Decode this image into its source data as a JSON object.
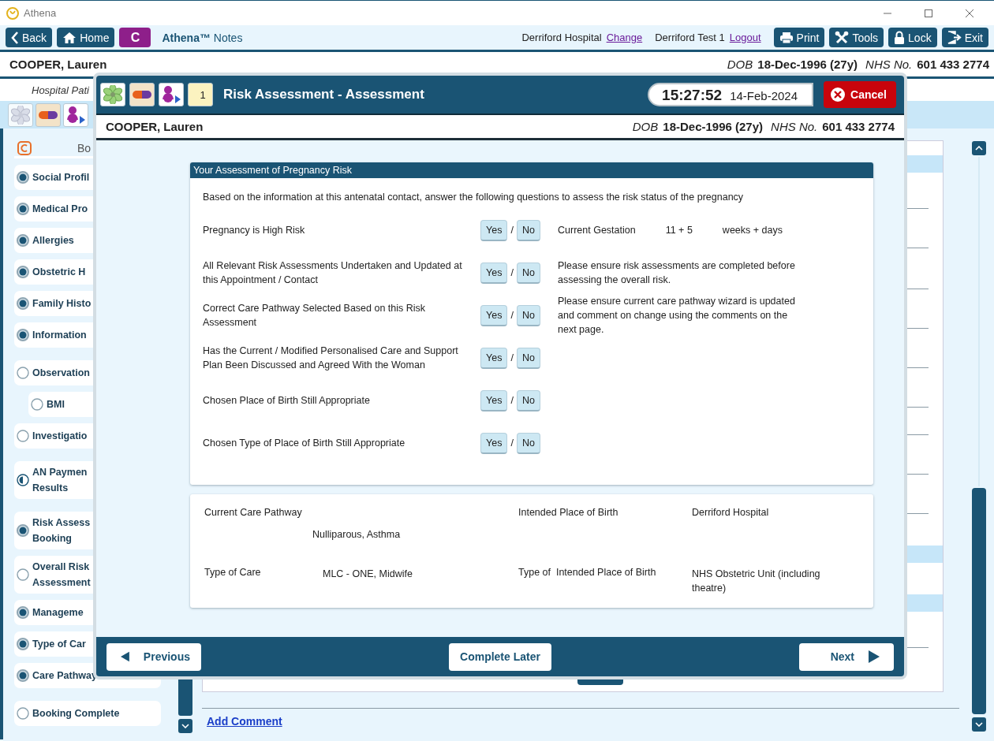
{
  "window": {
    "title": "Athena"
  },
  "toolbar": {
    "left_buttons": [
      {
        "kind": "back",
        "label": "Back"
      },
      {
        "kind": "home",
        "label": "Home"
      },
      {
        "kind": "letter",
        "label": "C"
      }
    ],
    "brand": "**Athena™** Notes",
    "location": "Derriford Hospital",
    "change_link": "Change",
    "user": "Derriford Test 1",
    "logout_link": "Logout",
    "right_buttons": [
      {
        "kind": "print",
        "label": "Print"
      },
      {
        "kind": "tools",
        "label": "Tools"
      },
      {
        "kind": "lock",
        "label": "Lock"
      },
      {
        "kind": "exit",
        "label": "Exit"
      }
    ]
  },
  "patient_bar": {
    "name": "COOPER, Lauren",
    "dob_label": "DOB",
    "dob": "18-Dec-1996 (27y)",
    "nhs_label": "NHS No.",
    "nhs": "601 433 2774"
  },
  "subheader": "Hospital Pati",
  "quick_icons": [
    {
      "kind": "flower",
      "disabled": true
    },
    {
      "kind": "pill",
      "disabled": false
    },
    {
      "kind": "person",
      "disabled": false
    }
  ],
  "sidebar": {
    "header": "Bo",
    "items": [
      {
        "label": "Social Profil",
        "kind": "complete"
      },
      {
        "label": "Medical Pro",
        "kind": "complete"
      },
      {
        "label": "Allergies",
        "kind": "complete"
      },
      {
        "label": "Obstetric H",
        "kind": "complete"
      },
      {
        "label": "Family Histo",
        "kind": "complete"
      },
      {
        "label": "Information",
        "kind": "complete"
      },
      {
        "label": "Observation",
        "kind": "empty",
        "children": [
          {
            "label": "BMI",
            "kind": "empty"
          }
        ]
      },
      {
        "label": "Investigatio",
        "kind": "empty"
      },
      {
        "label": "AN Paymen\nResults",
        "kind": "partial"
      },
      {
        "label": "Risk Assess\nBooking",
        "kind": "complete"
      },
      {
        "label": "Overall Risk\nAssessment",
        "kind": "empty"
      },
      {
        "label": "Manageme",
        "kind": "complete"
      },
      {
        "label": "Type of Car",
        "kind": "complete"
      },
      {
        "label": "Care Pathway",
        "kind": "complete"
      },
      {
        "label": "Booking Complete",
        "kind": "empty"
      }
    ]
  },
  "main": {
    "add_comment_link": "Add Comment"
  },
  "modal": {
    "icons": [
      {
        "kind": "flower",
        "disabled": false
      },
      {
        "kind": "pill",
        "disabled": false
      },
      {
        "kind": "person",
        "disabled": false
      },
      {
        "kind": "calendar",
        "disabled": false,
        "text": "1"
      }
    ],
    "title": "Risk Assessment - Assessment",
    "time": "15:27:52",
    "date": "14-Feb-2024",
    "cancel": "Cancel",
    "patient": {
      "name": "COOPER, Lauren",
      "dob_label": "DOB",
      "dob": "18-Dec-1996 (27y)",
      "nhs_label": "NHS No.",
      "nhs": "601 433 2774"
    },
    "section_title": "Your Assessment of Pregnancy Risk",
    "intro": "Based on the information at this antenatal contact, answer the following questions to assess the risk status of the pregnancy",
    "questions": [
      {
        "text": "Pregnancy is High Risk",
        "yes": "Yes",
        "separator": "/",
        "no": "No",
        "gestation": {
          "label": "Current Gestation",
          "value": "11 + 5",
          "unit": "weeks + days"
        }
      },
      {
        "text": "All Relevant Risk Assessments Undertaken and Updated at this Appointment / Contact",
        "yes": "Yes",
        "separator": "/",
        "no": "No",
        "note": "Please ensure risk assessments are completed before assessing the overall risk."
      },
      {
        "text": "Correct Care Pathway Selected Based on this Risk Assessment",
        "yes": "Yes",
        "separator": "/",
        "no": "No",
        "note": "Please ensure current care pathway wizard is updated and comment on change using the comments on the next page."
      },
      {
        "text": "Has the Current / Modified Personalised Care and Support Plan Been Discussed and Agreed With the Woman",
        "yes": "Yes",
        "separator": "/",
        "no": "No"
      },
      {
        "text": "Chosen Place of Birth Still Appropriate",
        "yes": "Yes",
        "separator": "/",
        "no": "No"
      },
      {
        "text": "Chosen Type of Place of Birth Still Appropriate",
        "yes": "Yes",
        "separator": "/",
        "no": "No"
      }
    ],
    "summary": [
      {
        "label": "Current Care Pathway",
        "value": "Nulliparous, Asthma"
      },
      {
        "label": "Intended Place of Birth",
        "value": "Derriford Hospital"
      },
      {
        "label": "Type of Care",
        "value": "MLC - ONE, Midwife"
      },
      {
        "label": "Type of  Intended Place of Birth",
        "value": "NHS Obstetric Unit (including theatre)"
      }
    ],
    "previous": "Previous",
    "complete_later": "Complete Later",
    "next": "Next"
  }
}
